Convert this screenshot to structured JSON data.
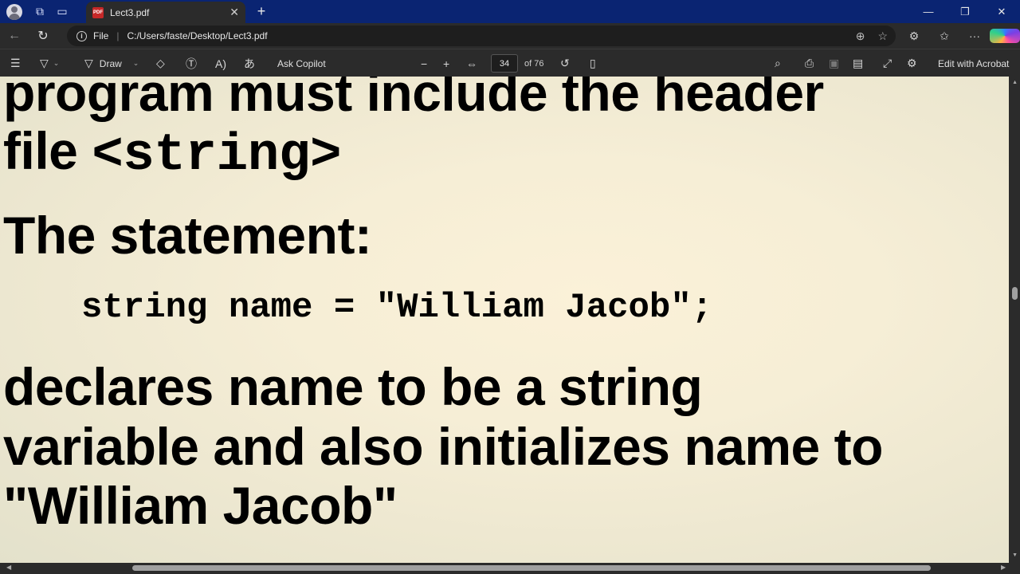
{
  "browser": {
    "tab_title": "Lect3.pdf",
    "new_tab_symbol": "+",
    "url_scheme_label": "File",
    "url": "C:/Users/faste/Desktop/Lect3.pdf"
  },
  "pdf_toolbar": {
    "draw_label": "Draw",
    "ask_copilot_label": "Ask Copilot",
    "current_page": "34",
    "page_count_label": "of 76",
    "edit_with_acrobat_label": "Edit with Acrobat"
  },
  "document": {
    "line1": "program must include the header",
    "line2_prefix": "file ",
    "line2_code": "<string>",
    "heading": "The statement:",
    "code_line": "string name = \"William Jacob\";",
    "para_line1": "declares name to be a string",
    "para_line2": "variable and also initializes name to",
    "para_line3": "\"William Jacob\""
  },
  "colors": {
    "tabbar_bg": "#0a2472",
    "chrome_bg": "#2b2b2b",
    "page_bg": "#f6eed6",
    "text": "#000000"
  }
}
